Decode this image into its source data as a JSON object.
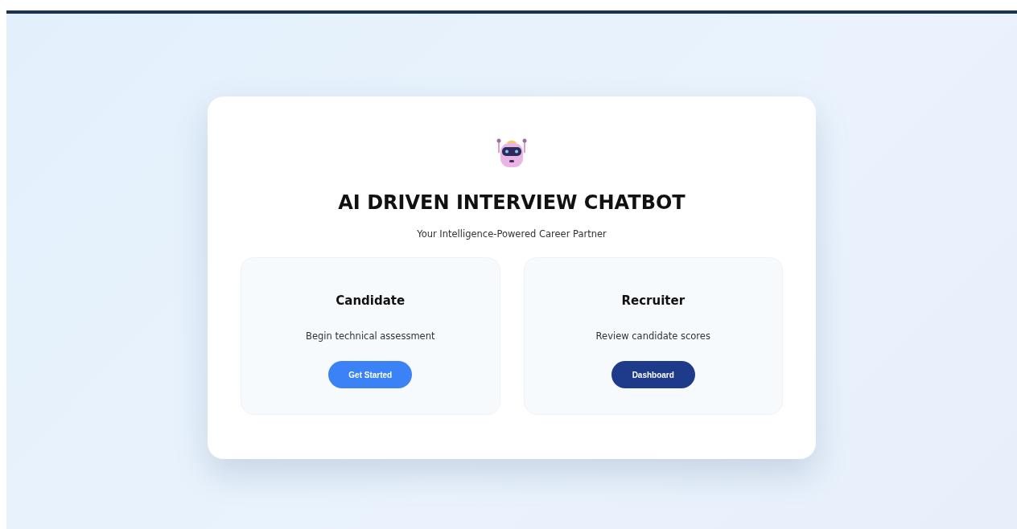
{
  "title": "AI DRIVEN INTERVIEW CHATBOT",
  "subtitle": "Your Intelligence-Powered Career Partner",
  "roles": [
    {
      "title": "Candidate",
      "description": "Begin technical assessment",
      "button": {
        "label": "Get Started",
        "color": "#3b82f6"
      }
    },
    {
      "title": "Recruiter",
      "description": "Review candidate scores",
      "button": {
        "label": "Dashboard",
        "color": "#1e3a8a"
      }
    }
  ]
}
